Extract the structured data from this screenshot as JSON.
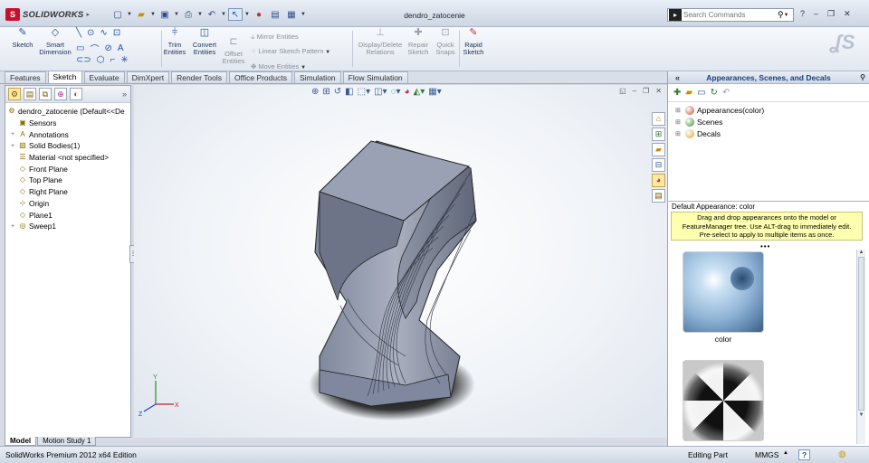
{
  "app": {
    "name": "SOLIDWORKS",
    "doc_title": "dendro_zatocenie"
  },
  "search": {
    "placeholder": "Search Commands"
  },
  "command_manager": {
    "sketch": "Sketch",
    "smart_dimension": [
      "Smart",
      "Dimension"
    ],
    "trim_entities": [
      "Trim",
      "Entities"
    ],
    "convert_entities": [
      "Convert",
      "Entities"
    ],
    "offset_entities": [
      "Offset",
      "Entities"
    ],
    "mirror_entities": "Mirror Entities",
    "linear_sketch_pattern": "Linear Sketch Pattern",
    "move_entities": "Move Entities",
    "display_delete_relations": [
      "Display/Delete",
      "Relations"
    ],
    "repair_sketch": [
      "Repair",
      "Sketch"
    ],
    "quick_snaps": [
      "Quick",
      "Snaps"
    ],
    "rapid_sketch": [
      "Rapid",
      "Sketch"
    ]
  },
  "tabs": [
    "Features",
    "Sketch",
    "Evaluate",
    "DimXpert",
    "Render Tools",
    "Office Products",
    "Simulation",
    "Flow Simulation"
  ],
  "active_tab": "Sketch",
  "feature_tree": {
    "root": "dendro_zatocenie  (Default<<De",
    "items": [
      {
        "label": "Sensors",
        "expand": "",
        "icon": "sensors-icon"
      },
      {
        "label": "Annotations",
        "expand": "+",
        "icon": "annotations-icon"
      },
      {
        "label": "Solid Bodies(1)",
        "expand": "+",
        "icon": "solid-bodies-icon"
      },
      {
        "label": "Material <not specified>",
        "expand": "",
        "icon": "material-icon"
      },
      {
        "label": "Front Plane",
        "expand": "",
        "icon": "plane-icon"
      },
      {
        "label": "Top Plane",
        "expand": "",
        "icon": "plane-icon"
      },
      {
        "label": "Right Plane",
        "expand": "",
        "icon": "plane-icon"
      },
      {
        "label": "Origin",
        "expand": "",
        "icon": "origin-icon"
      },
      {
        "label": "Plane1",
        "expand": "",
        "icon": "plane-icon"
      },
      {
        "label": "Sweep1",
        "expand": "+",
        "icon": "sweep-icon"
      }
    ]
  },
  "task_pane": {
    "title": "Appearances, Scenes, and Decals",
    "tree": [
      {
        "label": "Appearances(color)",
        "color": "#d04a2a"
      },
      {
        "label": "Scenes",
        "color": "#3a8a3a"
      },
      {
        "label": "Decals",
        "color": "#e0a020"
      }
    ],
    "default_appearance": "Default Appearance: color",
    "tip": [
      "Drag and drop appearances onto the model or",
      "FeatureManager tree.  Use ALT-drag to immediately edit.",
      "Pre-select to apply to multiple items as once."
    ],
    "swatches": [
      {
        "label": "color"
      },
      {
        "label": ""
      }
    ]
  },
  "model_tabs": [
    "Model",
    "Motion Study 1"
  ],
  "status": {
    "edition": "SolidWorks Premium 2012 x64 Edition",
    "mode": "Editing Part",
    "units": "MMGS",
    "help": "?"
  },
  "colors": {
    "accent": "#1f4fa0",
    "model": "#8c94a8",
    "titlebar": "#dde4ef"
  }
}
